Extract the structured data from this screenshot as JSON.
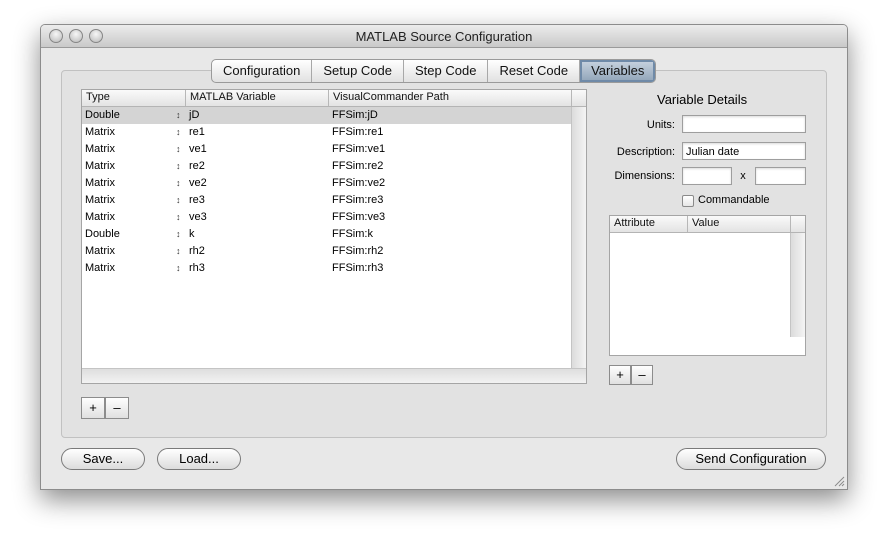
{
  "window": {
    "title": "MATLAB Source Configuration"
  },
  "tabs": [
    "Configuration",
    "Setup Code",
    "Step Code",
    "Reset Code",
    "Variables"
  ],
  "active_tab": "Variables",
  "variables_table": {
    "columns": [
      "Type",
      "MATLAB Variable",
      "VisualCommander Path"
    ],
    "rows": [
      {
        "type": "Double",
        "variable": "jD",
        "path": "FFSim:jD"
      },
      {
        "type": "Matrix",
        "variable": "re1",
        "path": "FFSim:re1"
      },
      {
        "type": "Matrix",
        "variable": "ve1",
        "path": "FFSim:ve1"
      },
      {
        "type": "Matrix",
        "variable": "re2",
        "path": "FFSim:re2"
      },
      {
        "type": "Matrix",
        "variable": "ve2",
        "path": "FFSim:ve2"
      },
      {
        "type": "Matrix",
        "variable": "re3",
        "path": "FFSim:re3"
      },
      {
        "type": "Matrix",
        "variable": "ve3",
        "path": "FFSim:ve3"
      },
      {
        "type": "Double",
        "variable": "k",
        "path": "FFSim:k"
      },
      {
        "type": "Matrix",
        "variable": "rh2",
        "path": "FFSim:rh2"
      },
      {
        "type": "Matrix",
        "variable": "rh3",
        "path": "FFSim:rh3"
      }
    ],
    "selected_row": 0,
    "add_label": "+",
    "remove_label": "–"
  },
  "details": {
    "title": "Variable Details",
    "units_label": "Units:",
    "units_value": "",
    "description_label": "Description:",
    "description_value": "Julian date",
    "dimensions_label": "Dimensions:",
    "dim_rows_value": "",
    "dim_separator": "x",
    "dim_cols_value": "",
    "commandable_label": "Commandable",
    "commandable_checked": false,
    "attributes": {
      "columns": [
        "Attribute",
        "Value"
      ],
      "rows": []
    },
    "add_label": "+",
    "remove_label": "–"
  },
  "footer": {
    "save_label": "Save...",
    "load_label": "Load...",
    "send_label": "Send Configuration"
  }
}
